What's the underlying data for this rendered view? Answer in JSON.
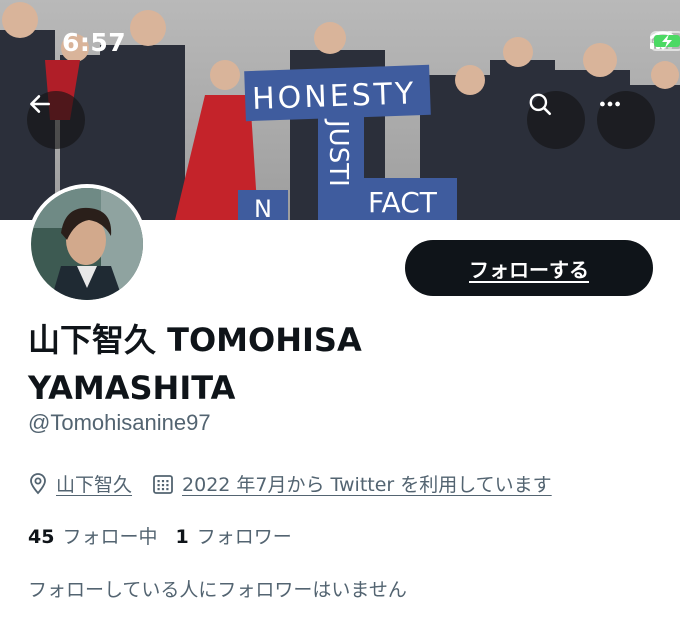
{
  "status_bar": {
    "time": "6:57"
  },
  "banner": {
    "sign_words": [
      "HONESTY",
      "JUSTI",
      "FACT",
      "N"
    ]
  },
  "header": {
    "back_icon": "arrow-left-icon",
    "search_icon": "search-icon",
    "more_icon": "more-dots-icon"
  },
  "profile": {
    "display_name": "山下智久 TOMOHISA YAMASHITA",
    "handle": "@Tomohisanine97",
    "location": "山下智久",
    "joined": "2022 年7月から Twitter を利用しています",
    "following_count": "45",
    "following_label": "フォロー中",
    "followers_count": "1",
    "followers_label": "フォロワー",
    "note": "フォローしている人にフォロワーはいません"
  },
  "actions": {
    "follow_label": "フォローする"
  },
  "colors": {
    "primary_text": "#0f1419",
    "secondary_text": "#536471",
    "button_bg": "#0f1419",
    "battery_green": "#4cd964"
  }
}
